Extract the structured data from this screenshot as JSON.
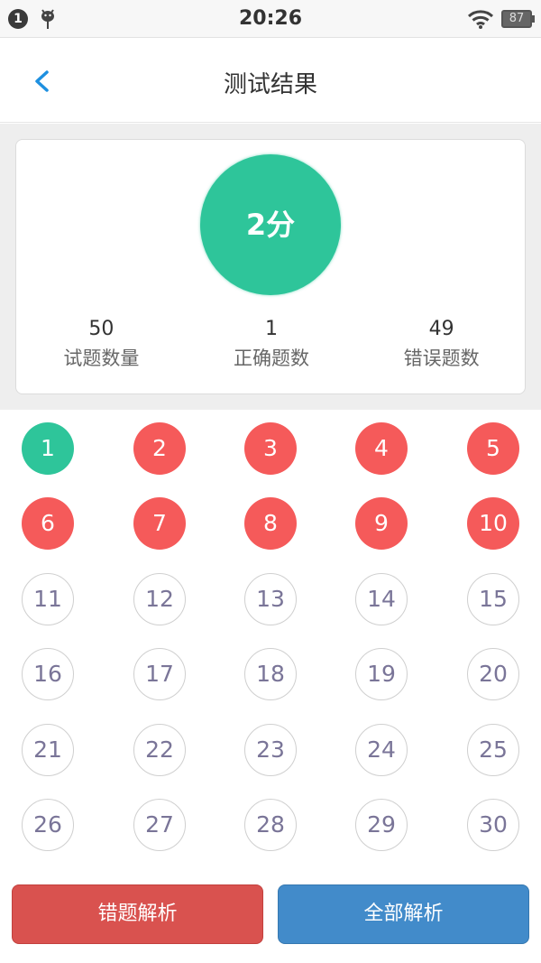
{
  "status_bar": {
    "notification_count": "1",
    "time": "20:26",
    "battery": "87",
    "icons": [
      "notification-badge-icon",
      "android-debug-icon",
      "wifi-icon",
      "battery-icon"
    ]
  },
  "header": {
    "title": "测试结果",
    "back_icon": "chevron-left-icon",
    "accent_color": "#1e90e0"
  },
  "summary": {
    "score": "2分",
    "stats": [
      {
        "value": "50",
        "label": "试题数量"
      },
      {
        "value": "1",
        "label": "正确题数"
      },
      {
        "value": "49",
        "label": "错误题数"
      }
    ]
  },
  "questions": [
    {
      "n": "1",
      "status": "correct"
    },
    {
      "n": "2",
      "status": "wrong"
    },
    {
      "n": "3",
      "status": "wrong"
    },
    {
      "n": "4",
      "status": "wrong"
    },
    {
      "n": "5",
      "status": "wrong"
    },
    {
      "n": "6",
      "status": "wrong"
    },
    {
      "n": "7",
      "status": "wrong"
    },
    {
      "n": "8",
      "status": "wrong"
    },
    {
      "n": "9",
      "status": "wrong"
    },
    {
      "n": "10",
      "status": "wrong"
    },
    {
      "n": "11",
      "status": "unanswered"
    },
    {
      "n": "12",
      "status": "unanswered"
    },
    {
      "n": "13",
      "status": "unanswered"
    },
    {
      "n": "14",
      "status": "unanswered"
    },
    {
      "n": "15",
      "status": "unanswered"
    },
    {
      "n": "16",
      "status": "unanswered"
    },
    {
      "n": "17",
      "status": "unanswered"
    },
    {
      "n": "18",
      "status": "unanswered"
    },
    {
      "n": "19",
      "status": "unanswered"
    },
    {
      "n": "20",
      "status": "unanswered"
    },
    {
      "n": "21",
      "status": "unanswered"
    },
    {
      "n": "22",
      "status": "unanswered"
    },
    {
      "n": "23",
      "status": "unanswered"
    },
    {
      "n": "24",
      "status": "unanswered"
    },
    {
      "n": "25",
      "status": "unanswered"
    },
    {
      "n": "26",
      "status": "unanswered"
    },
    {
      "n": "27",
      "status": "unanswered"
    },
    {
      "n": "28",
      "status": "unanswered"
    },
    {
      "n": "29",
      "status": "unanswered"
    },
    {
      "n": "30",
      "status": "unanswered"
    }
  ],
  "colors": {
    "correct": "#2ec59a",
    "wrong": "#f55a5a",
    "wrong_button": "#d9524f",
    "all_button": "#428bca"
  },
  "buttons": {
    "wrong_analysis": "错题解析",
    "all_analysis": "全部解析"
  }
}
